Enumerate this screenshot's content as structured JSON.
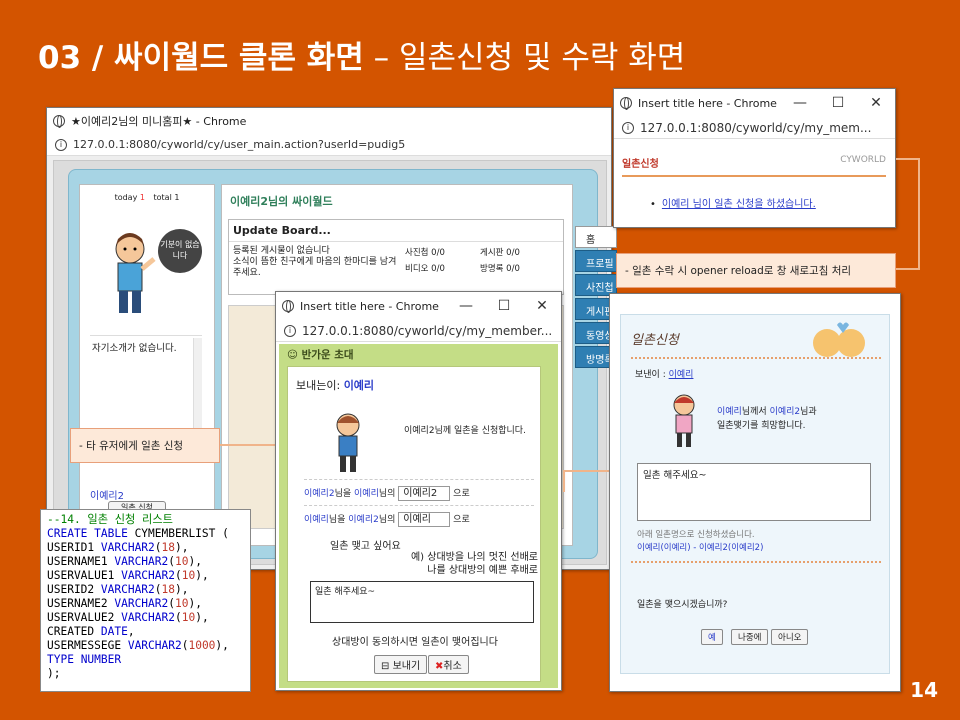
{
  "slide": {
    "title_bold": "03 / 싸이월드 클론 화면",
    "title_rest": "– 일촌신청 및 수락 화면",
    "page": "14"
  },
  "main_window": {
    "title": "★이예리2님의 미니홈피★ - Chrome",
    "url": "127.0.0.1:8080/cyworld/cy/user_main.action?userId=pudig5",
    "today_label": "today",
    "today_count": "1",
    "total_label": "total",
    "total_count": "1",
    "home_title": "이예리2님의 싸이월드",
    "speech": "기분이 없습니다",
    "intro": "자기소개가 없습니다.",
    "board_title": "Update Board...",
    "board_msg1": "등록된 게시물이 없습니다",
    "board_msg2": "소식이 뜸한 친구에게 마음의 한마디를 남겨주세요.",
    "stats": [
      {
        "label": "사진첩",
        "value": "0/0"
      },
      {
        "label": "게시판",
        "value": "0/0"
      },
      {
        "label": "비디오",
        "value": "0/0"
      },
      {
        "label": "방명록",
        "value": "0/0"
      }
    ],
    "nav": [
      "홈",
      "프로필",
      "사진첩",
      "게시판",
      "동영상",
      "방명록"
    ],
    "username": "이예리2",
    "apply_button": "일촌 신청"
  },
  "note_left": "- 타 유저에게 일촌 신청",
  "note_right": "- 일촌 수락 시 opener reload로 창 새로고침 처리",
  "code_lines": [
    [
      {
        "t": "--14. 일촌 신청 리스트",
        "c": "c"
      }
    ],
    [
      {
        "t": "CREATE TABLE",
        "c": "k"
      },
      {
        "t": " CYMEMBERLIST (",
        "c": ""
      }
    ],
    [
      {
        "t": "USERID1 ",
        "c": ""
      },
      {
        "t": "VARCHAR2",
        "c": "k"
      },
      {
        "t": "(",
        "c": ""
      },
      {
        "t": "18",
        "c": "n"
      },
      {
        "t": "),",
        "c": ""
      }
    ],
    [
      {
        "t": "USERNAME1 ",
        "c": ""
      },
      {
        "t": "VARCHAR2",
        "c": "k"
      },
      {
        "t": "(",
        "c": ""
      },
      {
        "t": "10",
        "c": "n"
      },
      {
        "t": "),",
        "c": ""
      }
    ],
    [
      {
        "t": "USERVALUE1 ",
        "c": ""
      },
      {
        "t": "VARCHAR2",
        "c": "k"
      },
      {
        "t": "(",
        "c": ""
      },
      {
        "t": "10",
        "c": "n"
      },
      {
        "t": "),",
        "c": ""
      }
    ],
    [
      {
        "t": "USERID2 ",
        "c": ""
      },
      {
        "t": "VARCHAR2",
        "c": "k"
      },
      {
        "t": "(",
        "c": ""
      },
      {
        "t": "18",
        "c": "n"
      },
      {
        "t": "),",
        "c": ""
      }
    ],
    [
      {
        "t": "USERNAME2 ",
        "c": ""
      },
      {
        "t": "VARCHAR2",
        "c": "k"
      },
      {
        "t": "(",
        "c": ""
      },
      {
        "t": "10",
        "c": "n"
      },
      {
        "t": "),",
        "c": ""
      }
    ],
    [
      {
        "t": "USERVALUE2 ",
        "c": ""
      },
      {
        "t": "VARCHAR2",
        "c": "k"
      },
      {
        "t": "(",
        "c": ""
      },
      {
        "t": "10",
        "c": "n"
      },
      {
        "t": "),",
        "c": ""
      }
    ],
    [
      {
        "t": "CREATED ",
        "c": ""
      },
      {
        "t": "DATE",
        "c": "k"
      },
      {
        "t": ",",
        "c": ""
      }
    ],
    [
      {
        "t": "USERMESSEGE ",
        "c": ""
      },
      {
        "t": "VARCHAR2",
        "c": "k"
      },
      {
        "t": "(",
        "c": ""
      },
      {
        "t": "1000",
        "c": "n"
      },
      {
        "t": "),",
        "c": ""
      }
    ],
    [
      {
        "t": "TYPE ",
        "c": "k"
      },
      {
        "t": "NUMBER",
        "c": "k"
      }
    ],
    [
      {
        "t": ");",
        "c": ""
      }
    ]
  ],
  "invite_window": {
    "title": "Insert title here - Chrome",
    "url": "127.0.0.1:8080/cyworld/cy/my_member...",
    "header": "반가운 초대",
    "sender_label": "보내는이:",
    "sender": "이예리",
    "request_text": "이예리2님께 일촌을 신청합니다.",
    "r1_a": "이예리2",
    "r1_b": "님을",
    "r1_c": "이예리",
    "r1_d": "님의",
    "r1_val": "이예리2",
    "r1_e": "으로",
    "r2_a": "이예리",
    "r2_b": "님을",
    "r2_c": "이예리2",
    "r2_d": "님의",
    "r2_val": "이예리",
    "r2_e": "으로",
    "want": "일촌 맺고 싶어요",
    "ex1": "예) 상대방을 나의 멋진 선배로",
    "ex2": "나를 상대방의 예쁜 후배로",
    "message": "일촌 해주세요~",
    "agree": "상대방이 동의하시면 일촌이 맺어집니다",
    "send": "보내기",
    "cancel": "취소"
  },
  "notify_window": {
    "title": "Insert title here - Chrome",
    "url": "127.0.0.1:8080/cyworld/cy/my_mem...",
    "header": "일촌신청",
    "brand": "CYWORLD",
    "message": "이예리 님이 일촌 신청을 하셨습니다."
  },
  "accept_window": {
    "logo": "일촌신청",
    "sender_label": "보낸이 :",
    "sender": "이예리",
    "line1_a": "이예리",
    "line1_b": "님께서",
    "line1_c": "이예리2",
    "line1_d": "님과",
    "line2": "일촌맺기를 희망합니다.",
    "message": "일촌 해주세요~",
    "info1": "아래 일촌명으로 신청하셨습니다.",
    "info2": "이예리(이예리) - 이예리2(이예리2)",
    "question": "일촌을 맺으시겠습니까?",
    "yes": "예",
    "later": "나중에",
    "no": "아니오"
  }
}
